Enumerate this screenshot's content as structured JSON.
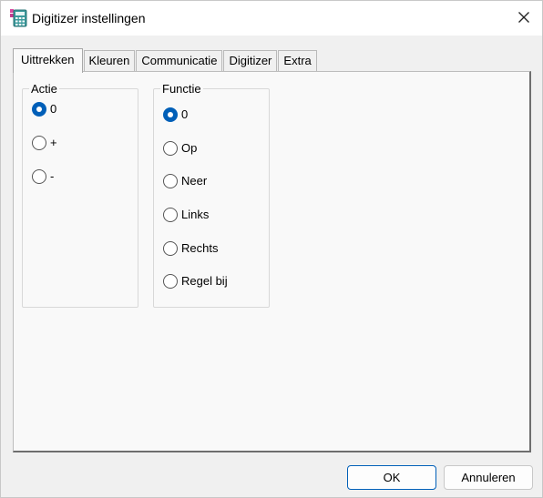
{
  "window": {
    "title": "Digitizer instellingen",
    "icon": "calculator-icon",
    "close_icon": "close-icon"
  },
  "tabs": [
    {
      "label": "Uittrekken",
      "active": true
    },
    {
      "label": "Kleuren",
      "active": false
    },
    {
      "label": "Communicatie",
      "active": false
    },
    {
      "label": "Digitizer",
      "active": false
    },
    {
      "label": "Extra",
      "active": false
    }
  ],
  "actie": {
    "legend": "Actie",
    "options": [
      {
        "label": "0",
        "checked": true
      },
      {
        "label": "+",
        "checked": false
      },
      {
        "label": "-",
        "checked": false
      }
    ]
  },
  "functie": {
    "legend": "Functie",
    "options": [
      {
        "label": "0",
        "checked": true
      },
      {
        "label": "Op",
        "checked": false
      },
      {
        "label": "Neer",
        "checked": false
      },
      {
        "label": "Links",
        "checked": false
      },
      {
        "label": "Rechts",
        "checked": false
      },
      {
        "label": "Regel bij",
        "checked": false
      }
    ]
  },
  "buttons": {
    "ok": "OK",
    "cancel": "Annuleren"
  },
  "colors": {
    "accent": "#005fb8",
    "window_bg": "#f0f0f0",
    "panel_bg": "#f9f9f9"
  }
}
